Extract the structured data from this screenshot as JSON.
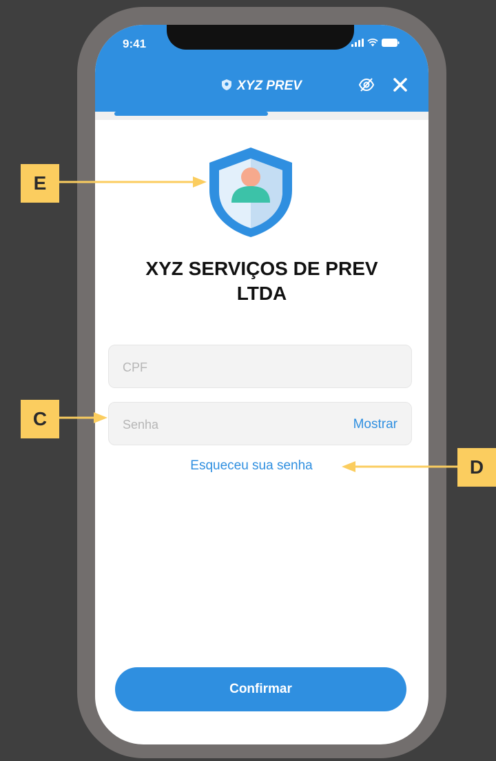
{
  "status_bar": {
    "time": "9:41"
  },
  "header": {
    "title": "XYZ PREV"
  },
  "company": {
    "name_line1": "XYZ SERVIÇOS DE PREV",
    "name_line2": "LTDA"
  },
  "form": {
    "cpf_placeholder": "CPF",
    "password_placeholder": "Senha",
    "show_password_label": "Mostrar",
    "forgot_password_link": "Esqueceu sua senha"
  },
  "actions": {
    "confirm_label": "Confirmar"
  },
  "annotations": {
    "logo_tag": "E",
    "password_tag": "C",
    "forgot_tag": "D"
  },
  "progress": {
    "fraction": 0.46
  },
  "icons": [
    "shield-icon",
    "eye-off-icon",
    "close-icon",
    "signal-icon",
    "wifi-icon",
    "battery-icon",
    "user-shield-logo"
  ],
  "colors": {
    "accent": "#2f8fe0",
    "callout": "#fbcd5f",
    "background": "#3f3f3f",
    "frame": "#726e6d"
  }
}
